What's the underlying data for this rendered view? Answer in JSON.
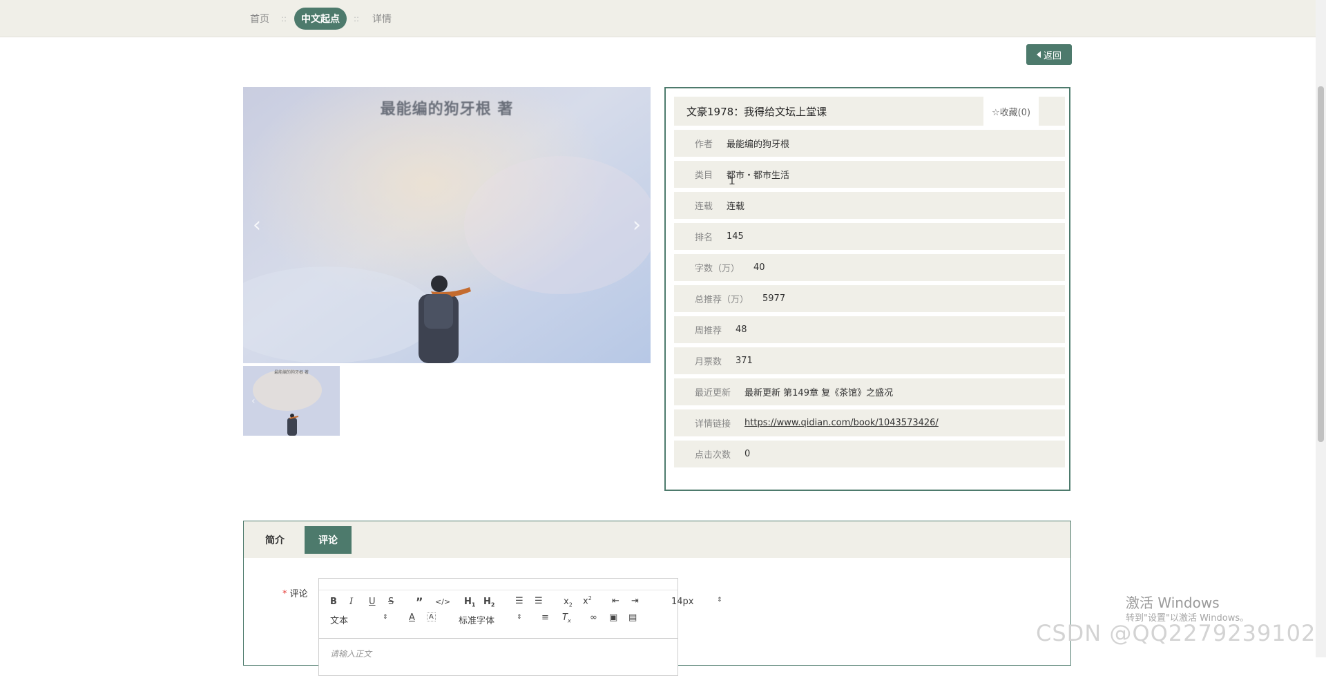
{
  "breadcrumb": {
    "home": "首页",
    "sep1": "::",
    "current": "中文起点",
    "sep2": "::",
    "detail": "详情"
  },
  "back_button": {
    "label": "返回"
  },
  "book": {
    "cover_text": "最能编的狗牙根 著",
    "title": "文豪1978：我得给文坛上堂课",
    "favorite": "☆收藏(0)",
    "fields": [
      {
        "label": "作者",
        "value": "最能编的狗牙根"
      },
      {
        "label": "类目",
        "value": "都市・都市生活"
      },
      {
        "label": "连载",
        "value": "连载"
      },
      {
        "label": "排名",
        "value": "145"
      },
      {
        "label": "字数（万）",
        "value": "40"
      },
      {
        "label": "总推荐（万）",
        "value": "5977"
      },
      {
        "label": "周推荐",
        "value": "48"
      },
      {
        "label": "月票数",
        "value": "371"
      },
      {
        "label": "最近更新",
        "value": "最新更新 第149章 复《茶馆》之盛况"
      },
      {
        "label": "详情链接",
        "value": "https://www.qidian.com/book/1043573426/"
      },
      {
        "label": "点击次数",
        "value": "0"
      }
    ]
  },
  "tabs": {
    "intro": "简介",
    "comment": "评论"
  },
  "comment_form": {
    "required_mark": "*",
    "label": "评论",
    "font_size": "14px",
    "block_format": "文本",
    "font_family": "标准字体",
    "placeholder": "请输入正文"
  },
  "watermark": {
    "activate_title": "激活 Windows",
    "activate_hint": "转到\"设置\"以激活 Windows。",
    "csdn": "CSDN @QQ2279239102"
  },
  "colors": {
    "accent": "#4d7a6c",
    "panel_bg": "#f0efe8"
  }
}
